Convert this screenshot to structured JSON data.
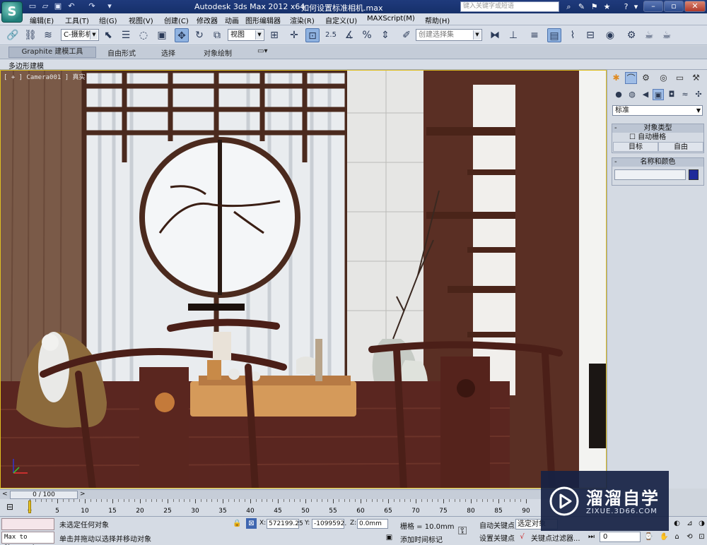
{
  "titlebar": {
    "app_title": "Autodesk 3ds Max  2012 x64",
    "file_name": "如何设置标准相机.max",
    "search_placeholder": "键入关键字或短语",
    "help_label": "?"
  },
  "menu": [
    "编辑(E)",
    "工具(T)",
    "组(G)",
    "视图(V)",
    "创建(C)",
    "修改器",
    "动画",
    "图形编辑器",
    "渲染(R)",
    "自定义(U)",
    "MAXScript(M)",
    "帮助(H)"
  ],
  "toolbar": {
    "selection_set": "C-摄影机",
    "ref_coord": "视图",
    "named_selection": "创建选择集",
    "percent_snap": "%",
    "angle_snap_value": "2.5"
  },
  "ribbon": {
    "tabs": [
      "Graphite 建模工具",
      "自由形式",
      "选择",
      "对象绘制"
    ],
    "sub_label": "多边形建模"
  },
  "viewport": {
    "label": "[ + ] Camera001 ] 真实 ]"
  },
  "command_panel": {
    "category": "标准",
    "rollout_object_type": "对象类型",
    "autogrid_label": "自动栅格",
    "btn_target": "目标",
    "btn_free": "自由",
    "rollout_name_color": "名称和颜色",
    "swatch_color": "#1f2a9a"
  },
  "timeline": {
    "frame_display": "0 / 100",
    "ticks": [
      "0",
      "5",
      "10",
      "15",
      "20",
      "25",
      "30",
      "35",
      "40",
      "45",
      "50",
      "55",
      "60",
      "65",
      "70",
      "75",
      "80",
      "85",
      "90"
    ]
  },
  "status": {
    "maxscript_text": "Max to Physcs (",
    "selection_status": "未选定任何对象",
    "prompt": "单击并拖动以选择并移动对象",
    "x_label": "X:",
    "x_value": "572199.25",
    "y_label": "Y:",
    "y_value": "-1099592.",
    "z_label": "Z:",
    "z_value": "0.0mm",
    "grid": "栅格 = 10.0mm",
    "add_time_tag": "添加时间标记",
    "auto_key": "自动关键点",
    "set_key": "设置关键点",
    "selected_combo": "选定对象",
    "key_filters": "关键点过滤器...",
    "frame": "0"
  },
  "watermark": {
    "title": "溜溜自学",
    "subtitle": "ZIXUE.3D66.COM"
  }
}
